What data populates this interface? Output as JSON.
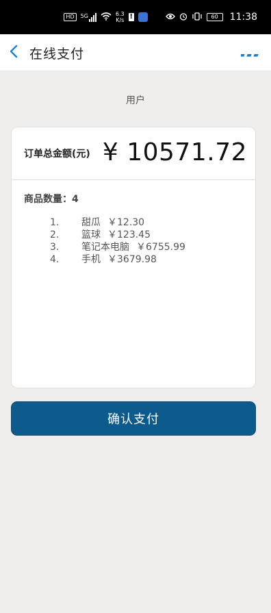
{
  "status_bar": {
    "hd": "HD",
    "network": "5G",
    "speed_value": "6.3",
    "speed_unit": "K/s",
    "battery": "60",
    "time": "11:38"
  },
  "header": {
    "title": "在线支付",
    "back_icon": "chevron-left-icon",
    "more_icon": "more-dots-icon"
  },
  "user_label": "用户",
  "order": {
    "total_label": "订单总金额(元)",
    "total_amount": "¥ 10571.72",
    "quantity_label": "商品数量：",
    "quantity_value": "4",
    "items": [
      {
        "num": "1.",
        "name": "甜瓜",
        "price": "￥12.30"
      },
      {
        "num": "2.",
        "name": "篮球",
        "price": "￥123.45"
      },
      {
        "num": "3.",
        "name": "笔记本电脑",
        "price": "￥6755.99"
      },
      {
        "num": "4.",
        "name": "手机",
        "price": "￥3679.98"
      }
    ]
  },
  "confirm_button": "确认支付",
  "colors": {
    "accent": "#1a7fd0",
    "button": "#0c5b8c",
    "background": "#f0eeec"
  }
}
